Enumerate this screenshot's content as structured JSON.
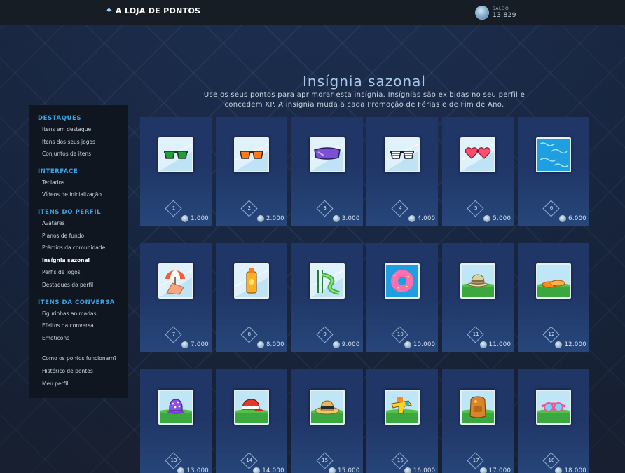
{
  "header": {
    "logo_text": "A LOJA DE PONTOS",
    "balance_label": "SALDO",
    "balance_value": "13.829"
  },
  "page": {
    "title": "Insígnia sazonal",
    "description": "Use os seus pontos para aprimorar esta insígnia. Insígnias são exibidas no seu perfil e concedem XP. A insígnia muda a cada Promoção de Férias e de Fim de Ano."
  },
  "sidebar": {
    "sections": [
      {
        "title": "DESTAQUES",
        "items": [
          "Itens em destaque",
          "Itens dos seus jogos",
          "Conjuntos de itens"
        ]
      },
      {
        "title": "INTERFACE",
        "items": [
          "Teclados",
          "Vídeos de inicialização"
        ]
      },
      {
        "title": "ITENS DO PERFIL",
        "items": [
          "Avatares",
          "Planos de fundo",
          "Prêmios da comunidade",
          "Insígnia sazonal",
          "Perfis de jogos",
          "Destaques do perfil"
        ]
      },
      {
        "title": "ITENS DA CONVERSA",
        "items": [
          "Figurinhas animadas",
          "Efeitos da conversa",
          "Emoticons"
        ]
      }
    ],
    "active_item": "Insígnia sazonal",
    "footer_links": [
      "Como os pontos funcionam?",
      "Histórico de pontos",
      "Meu perfil"
    ]
  },
  "badges": [
    {
      "level": "1",
      "price": "1.000",
      "icon": "green-sunglasses-icon"
    },
    {
      "level": "2",
      "price": "2.000",
      "icon": "orange-sunglasses-icon"
    },
    {
      "level": "3",
      "price": "3.000",
      "icon": "purple-visor-sunglasses-icon"
    },
    {
      "level": "4",
      "price": "4.000",
      "icon": "shutter-shades-icon"
    },
    {
      "level": "5",
      "price": "5.000",
      "icon": "heart-sunglasses-icon"
    },
    {
      "level": "6",
      "price": "6.000",
      "icon": "pool-water-icon"
    },
    {
      "level": "7",
      "price": "7.000",
      "icon": "beach-chair-umbrella-icon"
    },
    {
      "level": "8",
      "price": "8.000",
      "icon": "sunscreen-bottle-icon"
    },
    {
      "level": "9",
      "price": "9.000",
      "icon": "water-slide-icon"
    },
    {
      "level": "10",
      "price": "10.000",
      "icon": "pink-donut-float-icon"
    },
    {
      "level": "11",
      "price": "11.000",
      "icon": "bucket-hat-icon"
    },
    {
      "level": "12",
      "price": "12.000",
      "icon": "flip-flops-icon"
    },
    {
      "level": "13",
      "price": "13.000",
      "icon": "purple-polka-hat-icon"
    },
    {
      "level": "14",
      "price": "14.000",
      "icon": "red-cap-icon"
    },
    {
      "level": "15",
      "price": "15.000",
      "icon": "straw-hat-icon"
    },
    {
      "level": "16",
      "price": "16.000",
      "icon": "water-gun-icon"
    },
    {
      "level": "17",
      "price": "17.000",
      "icon": "backpack-icon"
    },
    {
      "level": "18",
      "price": "18.000",
      "icon": "swim-goggles-icon"
    }
  ],
  "colors": {
    "accent": "#3aa2e6",
    "topbar": "#171d25",
    "card": "#1b3263",
    "sidebar": "#10161f"
  }
}
